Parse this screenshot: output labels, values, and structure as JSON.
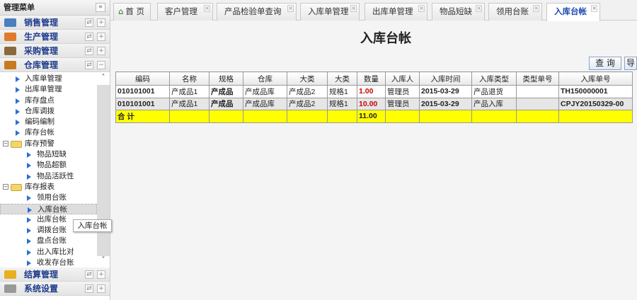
{
  "sidebar": {
    "title": "管理菜单",
    "sections": [
      {
        "label": "销售管理",
        "color": "#4a7fc0"
      },
      {
        "label": "生产管理",
        "color": "#e07b2a"
      },
      {
        "label": "采购管理",
        "color": "#8a6a3a"
      },
      {
        "label": "仓库管理",
        "color": "#c77a1e"
      }
    ],
    "tree": [
      {
        "label": "入库单管理"
      },
      {
        "label": "出库单管理"
      },
      {
        "label": "库存盘点"
      },
      {
        "label": "仓库调拨"
      },
      {
        "label": "编码编制"
      },
      {
        "label": "库存台帐"
      },
      {
        "label": "库存预警",
        "folder": true
      },
      {
        "label": "物品短缺"
      },
      {
        "label": "物品超额"
      },
      {
        "label": "物品活跃性"
      },
      {
        "label": "库存报表",
        "folder": true
      },
      {
        "label": "领用台账"
      },
      {
        "label": "入库台帐",
        "selected": true
      },
      {
        "label": "出库台帐"
      },
      {
        "label": "调拨台账"
      },
      {
        "label": "盘点台账"
      },
      {
        "label": "出入库比对"
      },
      {
        "label": "收发存台账"
      }
    ],
    "bottom_sections": [
      {
        "label": "结算管理",
        "color": "#e8b020"
      },
      {
        "label": "系统设置",
        "color": "#999999"
      }
    ],
    "tooltip": "入库台帐"
  },
  "tabs": [
    {
      "label": "首 页"
    },
    {
      "label": "客户管理"
    },
    {
      "label": "产品检验单查询"
    },
    {
      "label": "入库单管理"
    },
    {
      "label": "出库单管理"
    },
    {
      "label": "物品短缺"
    },
    {
      "label": "领用台账"
    },
    {
      "label": "入库台帐",
      "active": true
    }
  ],
  "main": {
    "title": "入库台帐",
    "query_button": "查 询",
    "export_button": "导",
    "columns": [
      "编码",
      "名称",
      "规格",
      "仓库",
      "大类",
      "大类",
      "数量",
      "入库人",
      "入库时间",
      "入库类型",
      "类型单号",
      "入库单号"
    ],
    "rows": [
      [
        "010101001",
        "产成品1",
        "产成品",
        "产成品库",
        "产成品2",
        "规格1",
        "1.00",
        "管理员",
        "2015-03-29",
        "产品退货",
        "",
        "TH150000001"
      ],
      [
        "010101001",
        "产成品1",
        "产成品",
        "产成品库",
        "产成品2",
        "规格1",
        "10.00",
        "管理员",
        "2015-03-29",
        "产品入库",
        "",
        "CPJY20150329-00"
      ]
    ],
    "total_label": "合 计",
    "total_qty": "11.00"
  }
}
